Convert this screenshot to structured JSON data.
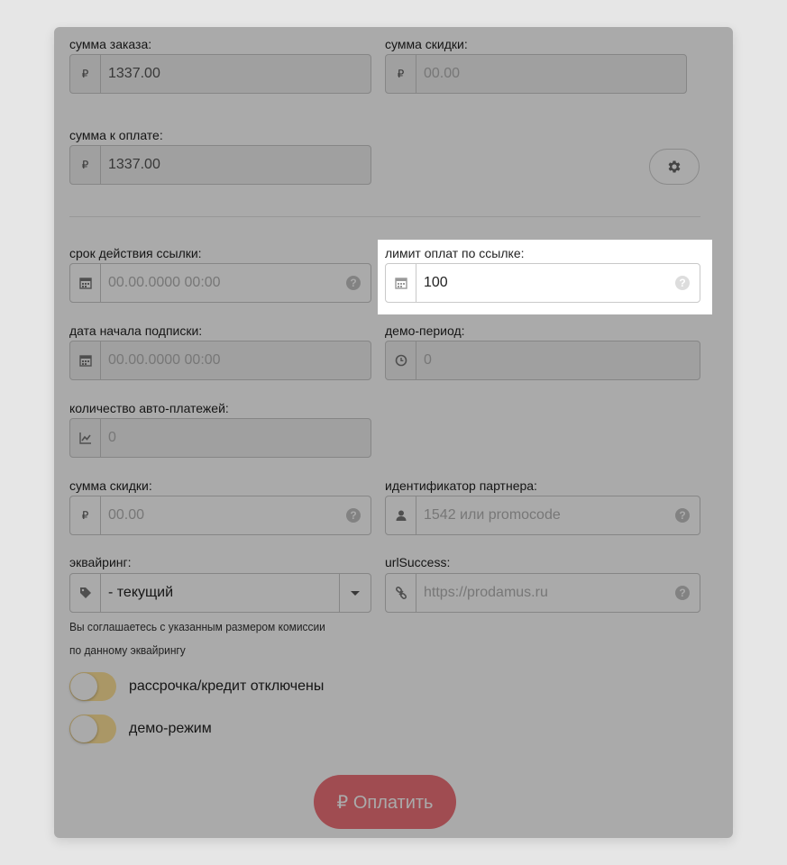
{
  "order_sum": {
    "label": "сумма заказа:",
    "currency": "₽",
    "value": "1337.00"
  },
  "discount_sum_top": {
    "label": "сумма скидки:",
    "currency": "₽",
    "placeholder": "00.00"
  },
  "pay_sum": {
    "label": "сумма к оплате:",
    "currency": "₽",
    "value": "1337.00"
  },
  "settings": {
    "icon": "gear-icon"
  },
  "link_expiry": {
    "label": "срок действия ссылки:",
    "placeholder": "00.00.0000 00:00",
    "help": "?"
  },
  "payment_limit": {
    "label": "лимит оплат по ссылке:",
    "value": "100",
    "help": "?"
  },
  "subscription_start": {
    "label": "дата начала подписки:",
    "placeholder": "00.00.0000 00:00"
  },
  "demo_period": {
    "label": "демо-период:",
    "placeholder": "0"
  },
  "auto_payments": {
    "label": "количество авто-платежей:",
    "placeholder": "0"
  },
  "discount_sum": {
    "label": "сумма скидки:",
    "currency": "₽",
    "placeholder": "00.00",
    "help": "?"
  },
  "partner_id": {
    "label": "идентификатор партнера:",
    "placeholder": "1542 или promocode",
    "help": "?"
  },
  "acquiring": {
    "label": "эквайринг:",
    "selected": "- текущий"
  },
  "url_success": {
    "label": "urlSuccess:",
    "placeholder": "https://prodamus.ru",
    "help": "?"
  },
  "commission_note": "Вы соглашаетесь с указанным размером комиссии по данному эквайрингу",
  "toggles": [
    {
      "label": "рассрочка/кредит отключены",
      "on": false
    },
    {
      "label": "демо-режим",
      "on": false
    }
  ],
  "pay_button": {
    "label": "₽ Оплатить"
  },
  "colors": {
    "page_bg": "#e6e6e6",
    "accent_button": "#f0727a",
    "toggle_track": "#ffe39a",
    "overlay": "rgba(0,0,0,0.335)"
  }
}
